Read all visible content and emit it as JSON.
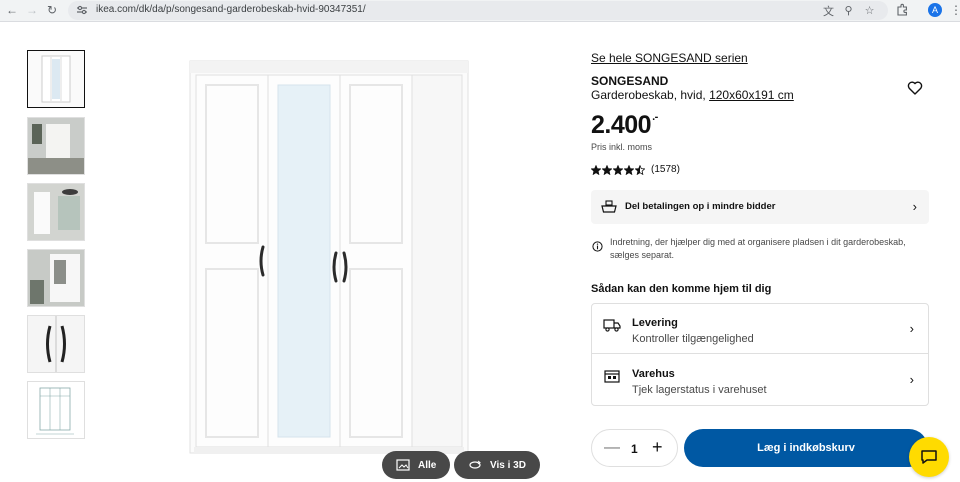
{
  "browser": {
    "url": "ikea.com/dk/da/p/songesand-garderobeskab-hvid-90347351/",
    "profile_initial": "A"
  },
  "gallery": {
    "all_label": "Alle",
    "view3d_label": "Vis i 3D"
  },
  "product": {
    "series_link": "Se hele SONGESAND serien",
    "name": "SONGESAND",
    "description": "Garderobeskab, hvid,",
    "dimensions": "120x60x191 cm",
    "price": "2.400",
    "price_suffix": ".-",
    "price_note": "Pris inkl. moms",
    "rating": 4.5,
    "review_count": "(1578)"
  },
  "payment": {
    "label": "Del betalingen op i mindre bidder"
  },
  "info": {
    "text": "Indretning, der hjælper dig med at organisere pladsen i dit garderobeskab, sælges separat."
  },
  "delivery": {
    "title": "Sådan kan den komme hjem til dig",
    "options": [
      {
        "title": "Levering",
        "subtitle": "Kontroller tilgængelighed",
        "icon": "truck-icon"
      },
      {
        "title": "Varehus",
        "subtitle": "Tjek lagerstatus i varehuset",
        "icon": "store-icon"
      }
    ]
  },
  "cart": {
    "quantity": "1",
    "add_label": "Læg i indkøbskurv"
  },
  "colors": {
    "primary_blue": "#0058a3",
    "chat_yellow": "#ffdb00",
    "pill_gray": "#484848"
  }
}
